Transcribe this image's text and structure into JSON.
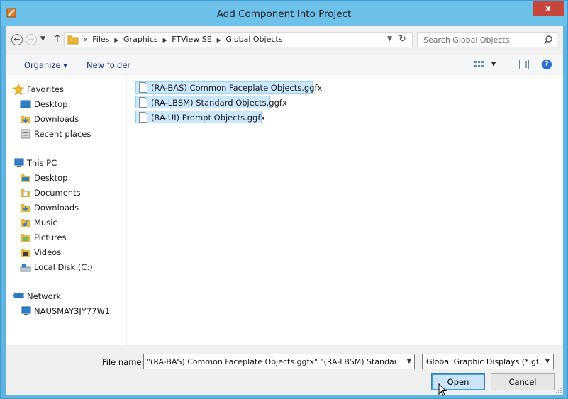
{
  "window": {
    "title": "Add Component Into Project",
    "close_label": "x"
  },
  "address": {
    "overflow": "«",
    "crumbs": [
      "Files",
      "Graphics",
      "FTView SE",
      "Global Objects"
    ]
  },
  "search": {
    "placeholder": "Search Global Objects"
  },
  "toolbar": {
    "organize_label": "Organize ▾",
    "new_folder_label": "New folder"
  },
  "nav": {
    "favorites": "Favorites",
    "fav_desktop": "Desktop",
    "fav_downloads": "Downloads",
    "fav_recent": "Recent places",
    "this_pc": "This PC",
    "pc_desktop": "Desktop",
    "pc_documents": "Documents",
    "pc_downloads": "Downloads",
    "pc_music": "Music",
    "pc_pictures": "Pictures",
    "pc_videos": "Videos",
    "pc_local_disk": "Local Disk (C:)",
    "network": "Network",
    "net_computer": "NAUSMAY3JY77W1"
  },
  "files": [
    {
      "name": "(RA-BAS) Common Faceplate Objects.ggfx",
      "selected": true
    },
    {
      "name": "(RA-LBSM) Standard Objects.ggfx",
      "selected": true
    },
    {
      "name": "(RA-UI) Prompt Objects.ggfx",
      "selected": true
    }
  ],
  "bottom": {
    "file_name_label": "File name:",
    "file_name_value": "\"(RA-BAS) Common Faceplate Objects.ggfx\" \"(RA-LBSM) Standard O",
    "file_type": "Global Graphic Displays (*.gfx; *",
    "open_label": "Open",
    "cancel_label": "Cancel"
  },
  "colors": {
    "title_bar": "#6cc0ea",
    "close_button": "#c7463b",
    "selection": "#cce8ff",
    "link_text": "#1e3287"
  }
}
